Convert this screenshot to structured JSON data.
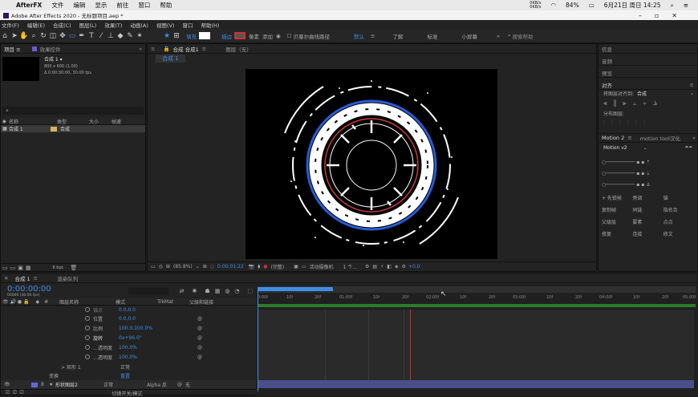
{
  "mac": {
    "app": "AfterFX",
    "menu": [
      "文件",
      "编辑",
      "显示",
      "前往",
      "窗口",
      "帮助"
    ],
    "status": {
      "net_up": "0KB/s",
      "net_down": "0KB/s",
      "battery": "84%",
      "datetime": "6月21日 周日 14:25"
    }
  },
  "window_title": "Adobe After Effects 2020 - 无标题项目.aep *",
  "menu": [
    "文件(F)",
    "编辑(E)",
    "合成(C)",
    "图层(L)",
    "效果(T)",
    "动画(A)",
    "视图(V)",
    "窗口",
    "帮助(H)"
  ],
  "toolbar": {
    "fill_label": "填充",
    "stroke_label": "描边",
    "stroke_px": "像素",
    "add_label": "添加",
    "bezier_label": "贝塞尔曲线路径",
    "workspaces": [
      "默认",
      "了解",
      "标准",
      "小屏幕"
    ],
    "search_placeholder": "搜索帮助"
  },
  "project": {
    "tabs": [
      "项目 ≡",
      "效果控件"
    ],
    "comp_name": "合成 1 ▾",
    "comp_size": "800 x 600 (1.00)",
    "comp_dur": "Δ 0:00:30:00, 30.00 fps",
    "search_icon": "⌕",
    "columns": [
      "名称",
      "类型",
      "大小",
      "帧速"
    ],
    "items": [
      {
        "name": "合成 1",
        "type": "合成"
      }
    ],
    "bpc": "8 bpc"
  },
  "comp_viewer": {
    "tab": "合成 合成1",
    "tab2": "图层（无）",
    "subtab": "合成 1",
    "zoom": "(85.8%)",
    "timecode": "0:00:01:22",
    "quality": "(完整)",
    "camera": "活动摄像机",
    "views": "1 个...",
    "exposure": "+0.0"
  },
  "right_panels": {
    "info": "信息",
    "audio": "音频",
    "preview": "预览",
    "align": "对齐",
    "align_to_label": "将图层对齐到:",
    "align_to_value": "合成",
    "distribute": "分布图层:",
    "motion_tab": "Motion 2",
    "motion_tab2": "motion tool汉化",
    "motion_ver": "Motion v2",
    "buttons": [
      "+ 先锁帧",
      "旁调",
      "锚",
      "复制帧",
      "同链",
      "指名合",
      "父级层",
      "要素",
      "点点",
      "修复",
      "连接",
      "修文"
    ]
  },
  "timeline": {
    "tab": "合成 1",
    "tab2": "渲染队列",
    "timecode": "0:00:00:00",
    "frame_info": "00000 (30.00 fps)",
    "columns": [
      "#",
      "图层名称",
      "模式",
      "TrkMat",
      "父级和链接"
    ],
    "props": [
      {
        "name": "锚点",
        "value": "0.0,0.0"
      },
      {
        "name": "位置",
        "value": "0.0,0.0"
      },
      {
        "name": "比例",
        "value": "100.0,100.0%"
      },
      {
        "name": "旋转",
        "value": "0x+96.0°"
      },
      {
        "name": "…透明度",
        "value": "100.0%"
      },
      {
        "name": "…透明度",
        "value": "100.0%"
      }
    ],
    "group1": "> 矩形 1",
    "group1_mode": "正常",
    "group2": "变换",
    "group2_value": "重置",
    "layer_index": "8",
    "layer_name": "形状图层2",
    "layer_mode": "正常",
    "layer_trk": "Alpha 反",
    "layer_parent": "无",
    "footer": "切换开关/模式",
    "ruler": [
      "0:00f",
      "10f",
      "20f",
      "01:00f",
      "10f",
      "20f",
      "02:00f",
      "10f",
      "20f",
      "03:00f",
      "10f",
      "20f",
      "04:00f",
      "10f",
      "20f",
      "05:00f"
    ]
  }
}
